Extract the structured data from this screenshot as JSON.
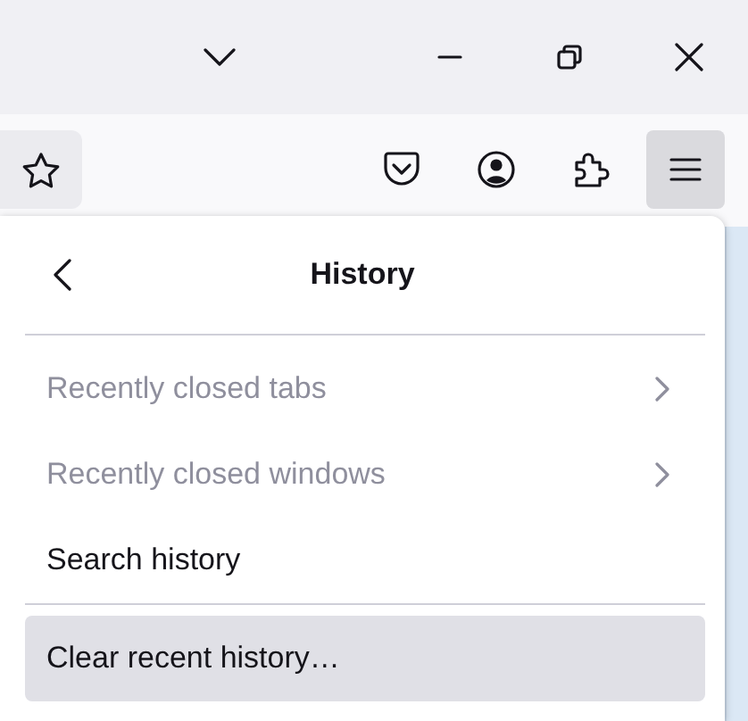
{
  "title_bar": {
    "buttons": [
      {
        "kind": "dropdown"
      },
      {
        "kind": "minimize"
      },
      {
        "kind": "restore"
      },
      {
        "kind": "close"
      }
    ]
  },
  "toolbar": {
    "buttons": [
      {
        "kind": "star",
        "selected": false
      },
      {
        "kind": "pocket",
        "selected": false
      },
      {
        "kind": "account",
        "selected": false
      },
      {
        "kind": "extensions",
        "selected": false
      },
      {
        "kind": "menu",
        "selected": true
      }
    ]
  },
  "panel": {
    "title": "History",
    "items": [
      {
        "kind": "item",
        "label": "Recently closed tabs",
        "disabled": true,
        "submenu": true,
        "highlighted": false
      },
      {
        "kind": "item",
        "label": "Recently closed windows",
        "disabled": true,
        "submenu": true,
        "highlighted": false
      },
      {
        "kind": "item",
        "label": "Search history",
        "disabled": false,
        "submenu": false,
        "highlighted": false
      },
      {
        "kind": "separator"
      },
      {
        "kind": "item",
        "label": "Clear recent history…",
        "disabled": false,
        "submenu": false,
        "highlighted": true
      }
    ]
  }
}
